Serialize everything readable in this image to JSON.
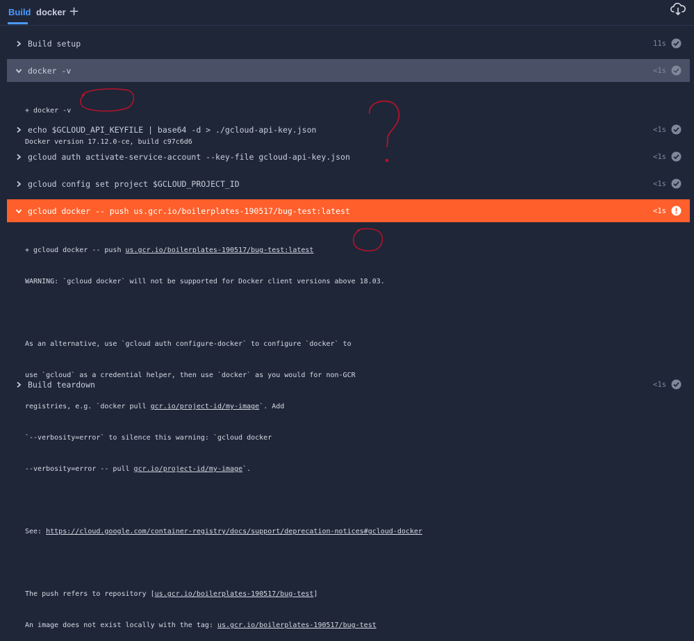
{
  "tabs": [
    {
      "label": "Build",
      "active": true
    },
    {
      "label": "docker",
      "active": false
    }
  ],
  "add_tab_label": "+",
  "icons": {
    "add": "plus-icon",
    "download": "cloud-download-icon",
    "success": "check-circle-icon",
    "error": "exclamation-circle-icon"
  },
  "colors": {
    "accent": "#4c9aff",
    "error": "#ff5f2b",
    "selected": "#4a5167",
    "background": "#1f2638",
    "annotation": "#b0142a"
  },
  "steps": [
    {
      "label": "Build setup",
      "duration": "11s",
      "status": "success",
      "expanded": false
    },
    {
      "label": "docker -v",
      "duration": "<1s",
      "status": "success",
      "expanded": true
    },
    {
      "label": "echo $GCLOUD_API_KEYFILE | base64 -d > ./gcloud-api-key.json",
      "duration": "<1s",
      "status": "success",
      "expanded": false
    },
    {
      "label": "gcloud auth activate-service-account --key-file gcloud-api-key.json",
      "duration": "<1s",
      "status": "success",
      "expanded": false
    },
    {
      "label": "gcloud config set project $GCLOUD_PROJECT_ID",
      "duration": "<1s",
      "status": "success",
      "expanded": false
    },
    {
      "label": "gcloud docker -- push us.gcr.io/boilerplates-190517/bug-test:latest",
      "duration": "<1s",
      "status": "error",
      "expanded": true
    },
    {
      "label": "Build teardown",
      "duration": "<1s",
      "status": "success",
      "expanded": false
    }
  ],
  "log_docker": [
    "+ docker -v",
    "Docker version 17.12.0-ce, build c97c6d6"
  ],
  "log_push": {
    "l1_prefix": "+ gcloud docker -- push ",
    "l1_link": "us.gcr.io/boilerplates-190517/bug-test:latest",
    "l2": "WARNING: `gcloud docker` will not be supported for Docker client versions above 18.03.",
    "l4": "As an alternative, use `gcloud auth configure-docker` to configure `docker` to",
    "l5": "use `gcloud` as a credential helper, then use `docker` as you would for non-GCR",
    "l6_prefix": "registries, e.g. `docker pull ",
    "l6_link": "gcr.io/project-id/my-image",
    "l6_suffix": "`. Add",
    "l7": "`--verbosity=error` to silence this warning: `gcloud docker",
    "l8_prefix": "--verbosity=error -- pull ",
    "l8_link": "gcr.io/project-id/my-image",
    "l8_suffix": "`.",
    "l10_prefix": "See: ",
    "l10_link": "https://cloud.google.com/container-registry/docs/support/deprecation-notices#gcloud-docker",
    "l12_prefix": "The push refers to repository [",
    "l12_link": "us.gcr.io/boilerplates-190517/bug-test",
    "l12_suffix": "]",
    "l13_prefix": "An image does not exist locally with the tag: ",
    "l13_link": "us.gcr.io/boilerplates-190517/bug-test"
  }
}
